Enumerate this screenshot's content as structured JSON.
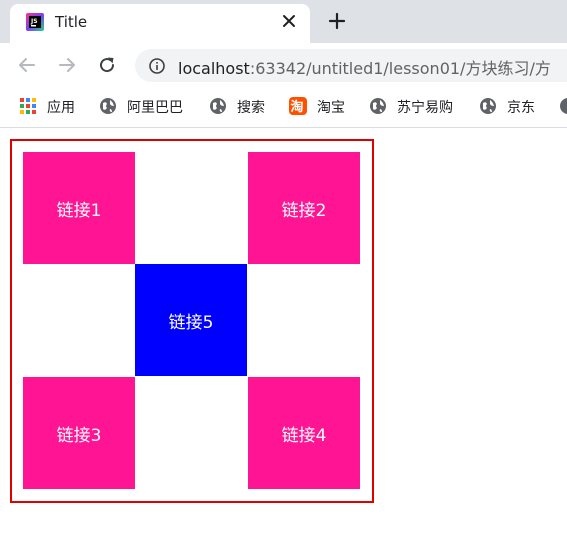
{
  "browser": {
    "tab_title": "Title",
    "url_host": "localhost",
    "url_path": ":63342/untitled1/lesson01/方块练习/方"
  },
  "bookmarks": [
    {
      "label": "应用",
      "icon": "apps-grid-icon"
    },
    {
      "label": "阿里巴巴",
      "icon": "globe-icon"
    },
    {
      "label": "搜索",
      "icon": "globe-icon"
    },
    {
      "label": "淘宝",
      "icon": "taobao-icon"
    },
    {
      "label": "苏宁易购",
      "icon": "globe-icon"
    },
    {
      "label": "京东",
      "icon": "globe-icon"
    }
  ],
  "page": {
    "links": [
      "链接1",
      "链接2",
      "链接5",
      "链接3",
      "链接4"
    ]
  },
  "colors": {
    "pink_block": "#ff1493",
    "blue_block": "#0000ff",
    "container_border": "#e00000"
  }
}
